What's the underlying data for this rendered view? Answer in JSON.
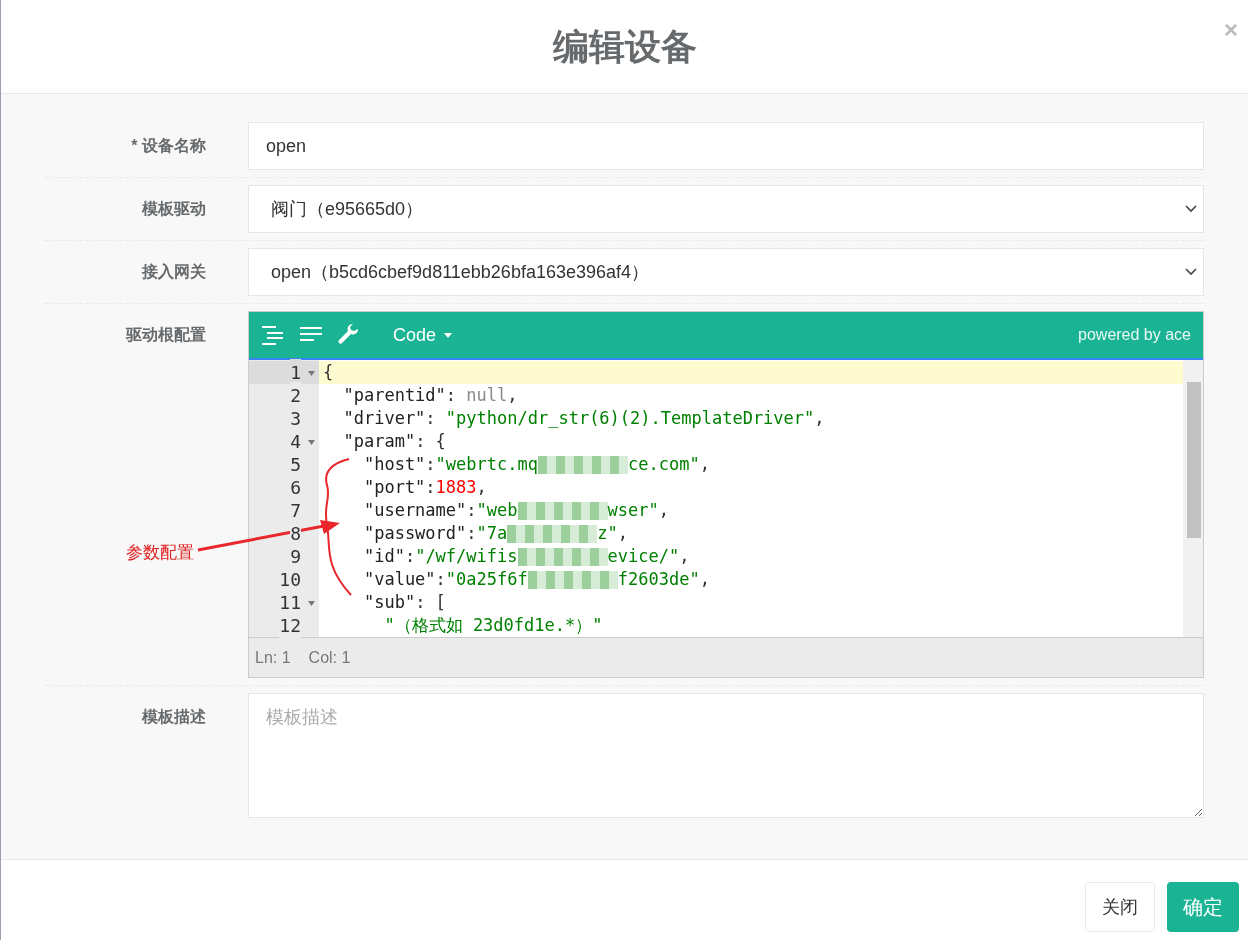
{
  "dialog": {
    "title": "编辑设备",
    "close": "×"
  },
  "fields": [
    {
      "kind": "input",
      "label": "* 设备名称",
      "value": "open"
    },
    {
      "kind": "select",
      "label": "模板驱动",
      "value": "阀门（e95665d0）"
    },
    {
      "kind": "select",
      "label": "接入网关",
      "value": "open（b5cd6cbef9d811ebb26bfa163e396af4）"
    },
    {
      "kind": "editor",
      "label": "驱动根配置"
    },
    {
      "kind": "textarea",
      "label": "模板描述",
      "placeholder": "模板描述"
    }
  ],
  "editor": {
    "mode": "Code",
    "credit": "powered by ace",
    "status": {
      "line": "Ln: 1",
      "col": "Col: 1"
    },
    "lines": [
      {
        "number": "1",
        "fold": true,
        "active": true,
        "tokens": [
          {
            "kind": "punct",
            "text": "{"
          }
        ]
      },
      {
        "number": "2",
        "fold": false,
        "active": false,
        "tokens": [
          {
            "kind": "key",
            "text": "  \"parentid\""
          },
          {
            "kind": "punct",
            "text": ": "
          },
          {
            "kind": "null",
            "text": "null"
          },
          {
            "kind": "punct",
            "text": ","
          }
        ]
      },
      {
        "number": "3",
        "fold": false,
        "active": false,
        "tokens": [
          {
            "kind": "key",
            "text": "  \"driver\""
          },
          {
            "kind": "punct",
            "text": ": "
          },
          {
            "kind": "string",
            "text": "\"python/dr_str(6)(2).TemplateDriver\""
          },
          {
            "kind": "punct",
            "text": ","
          }
        ]
      },
      {
        "number": "4",
        "fold": true,
        "active": false,
        "tokens": [
          {
            "kind": "key",
            "text": "  \"param\""
          },
          {
            "kind": "punct",
            "text": ": {"
          }
        ]
      },
      {
        "number": "5",
        "fold": false,
        "active": false,
        "tokens": [
          {
            "kind": "key",
            "text": "    \"host\""
          },
          {
            "kind": "punct",
            "text": ":"
          },
          {
            "kind": "string",
            "text": "\"webrtc.mq"
          },
          {
            "kind": "blur"
          },
          {
            "kind": "string",
            "text": "ce.com\""
          },
          {
            "kind": "punct",
            "text": ","
          }
        ]
      },
      {
        "number": "6",
        "fold": false,
        "active": false,
        "tokens": [
          {
            "kind": "key",
            "text": "    \"port\""
          },
          {
            "kind": "punct",
            "text": ":"
          },
          {
            "kind": "number",
            "text": "1883"
          },
          {
            "kind": "punct",
            "text": ","
          }
        ]
      },
      {
        "number": "7",
        "fold": false,
        "active": false,
        "tokens": [
          {
            "kind": "key",
            "text": "    \"username\""
          },
          {
            "kind": "punct",
            "text": ":"
          },
          {
            "kind": "string",
            "text": "\"web"
          },
          {
            "kind": "blur"
          },
          {
            "kind": "string",
            "text": "wser\""
          },
          {
            "kind": "punct",
            "text": ","
          }
        ]
      },
      {
        "number": "8",
        "fold": false,
        "active": false,
        "tokens": [
          {
            "kind": "key",
            "text": "    \"password\""
          },
          {
            "kind": "punct",
            "text": ":"
          },
          {
            "kind": "string",
            "text": "\"7a"
          },
          {
            "kind": "blur"
          },
          {
            "kind": "string",
            "text": "z\""
          },
          {
            "kind": "punct",
            "text": ","
          }
        ]
      },
      {
        "number": "9",
        "fold": false,
        "active": false,
        "tokens": [
          {
            "kind": "key",
            "text": "    \"id\""
          },
          {
            "kind": "punct",
            "text": ":"
          },
          {
            "kind": "string",
            "text": "\"/wf/wifis"
          },
          {
            "kind": "blur"
          },
          {
            "kind": "string",
            "text": "evice/\""
          },
          {
            "kind": "punct",
            "text": ","
          }
        ]
      },
      {
        "number": "10",
        "fold": false,
        "active": false,
        "tokens": [
          {
            "kind": "key",
            "text": "    \"value\""
          },
          {
            "kind": "punct",
            "text": ":"
          },
          {
            "kind": "string",
            "text": "\"0a25f6f"
          },
          {
            "kind": "blur"
          },
          {
            "kind": "string",
            "text": "f2603de\""
          },
          {
            "kind": "punct",
            "text": ","
          }
        ]
      },
      {
        "number": "11",
        "fold": true,
        "active": false,
        "tokens": [
          {
            "kind": "key",
            "text": "    \"sub\""
          },
          {
            "kind": "punct",
            "text": ": ["
          }
        ]
      },
      {
        "number": "12",
        "fold": false,
        "active": false,
        "tokens": [
          {
            "kind": "string",
            "text": "      \"（格式如 23d0fd1e.*）\""
          }
        ]
      }
    ]
  },
  "annotation": {
    "label": "参数配置"
  },
  "buttons": [
    {
      "kind": "secondary",
      "label": "关闭"
    },
    {
      "kind": "primary",
      "label": "确定"
    }
  ]
}
